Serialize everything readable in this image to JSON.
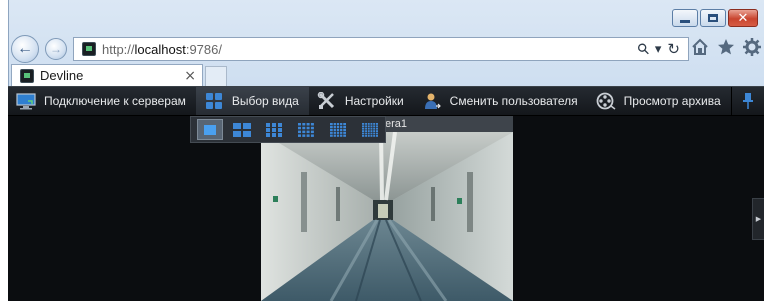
{
  "browser": {
    "url_prefix": "http://",
    "url_host": "localhost",
    "url_rest": ":9786/",
    "tab_title": "Devline",
    "tab_close": "×",
    "search_glyph": "⚲",
    "dropdown_glyph": "▾",
    "refresh_glyph": "↻",
    "icons": [
      "home-icon",
      "star-icon",
      "gear-icon"
    ]
  },
  "toolbar": {
    "items": [
      {
        "label": "Подключение к серверам",
        "icon": "monitor-icon"
      },
      {
        "label": "Выбор вида",
        "icon": "layout-grid-icon"
      },
      {
        "label": "Настройки",
        "icon": "tools-icon"
      },
      {
        "label": "Сменить пользователя",
        "icon": "user-switch-icon"
      },
      {
        "label": "Просмотр архива",
        "icon": "film-reel-icon"
      }
    ]
  },
  "layout_menu": {
    "options": [
      "1x1",
      "2x2",
      "3x3",
      "4x4",
      "5x5",
      "6x6"
    ],
    "selected": "1x1"
  },
  "camera": {
    "title_fragment": "era1"
  },
  "colors": {
    "app_bg": "#0b0d10",
    "toolbar_text": "#e8eaec",
    "icon_blue": "#3d87d6"
  }
}
